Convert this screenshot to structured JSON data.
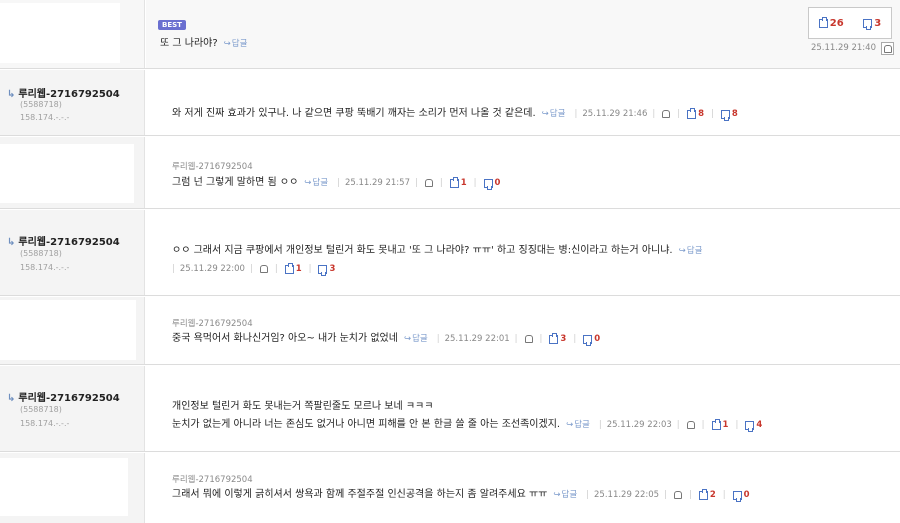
{
  "best": {
    "badge": "BEST",
    "text": "또 그 나라야?",
    "reply_label": "답글",
    "up": "26",
    "down": "3",
    "date": "25.11.29 21:40"
  },
  "comments": [
    {
      "author": "루리웹-2716792504",
      "uid": "(5588718)",
      "ip": "158.174.-.-.-",
      "text": "와 저게 진짜 효과가 있구나. 나 같으면 쿠팡 뚝배기 깨자는 소리가 먼저 나올 것 같은데.",
      "reply_label": "답글",
      "date": "25.11.29 21:46",
      "up": "8",
      "down": "8"
    },
    {
      "nick": "루리웹-2716792504",
      "text": "그럼 넌 그렇게 말하면 됨 ㅇㅇ",
      "reply_label": "답글",
      "date": "25.11.29 21:57",
      "up": "1",
      "down": "0"
    },
    {
      "author": "루리웹-2716792504",
      "uid": "(5588718)",
      "ip": "158.174.-.-.-",
      "text": "ㅇㅇ 그래서 지금 쿠팡에서 개인정보 털린거 화도 못내고 '또 그 나라야? ㅠㅠ' 하고 징징대는 병:신이라고 하는거 아니냐.",
      "reply_label": "답글",
      "date": "25.11.29 22:00",
      "up": "1",
      "down": "3"
    },
    {
      "nick": "루리웹-2716792504",
      "text": "중국 욕먹어서 화나신거임? 아오~ 내가 눈치가 없었네",
      "reply_label": "답글",
      "date": "25.11.29 22:01",
      "up": "3",
      "down": "0"
    },
    {
      "author": "루리웹-2716792504",
      "uid": "(5588718)",
      "ip": "158.174.-.-.-",
      "text": "개인정보 털린거 화도 못내는거 쪽팔린줄도 모르나 보네 ㅋㅋㅋ",
      "text2": "눈치가 없는게 아니라 너는 존심도 없거나 아니면 피해를 안 본 한글 쓸 줄 아는 조선족이겠지.",
      "reply_label": "답글",
      "date": "25.11.29 22:03",
      "up": "1",
      "down": "4"
    },
    {
      "nick": "루리웹-2716792504",
      "text": "그래서 뭐에 이렇게 긁히셔서 쌍욕과 함께 주절주절 인신공격을 하는지 좀 알려주세요 ㅠㅠ",
      "reply_label": "답글",
      "date": "25.11.29 22:05",
      "up": "2",
      "down": "0"
    }
  ],
  "icons": {
    "reply": "reply-arrow-icon",
    "report": "bell-icon",
    "upvote": "thumbs-up-icon",
    "downvote": "thumbs-down-icon"
  },
  "colors": {
    "best_badge": "#6a6fd0",
    "vote_count": "#c8372d",
    "reply_link": "#7b9acb"
  }
}
